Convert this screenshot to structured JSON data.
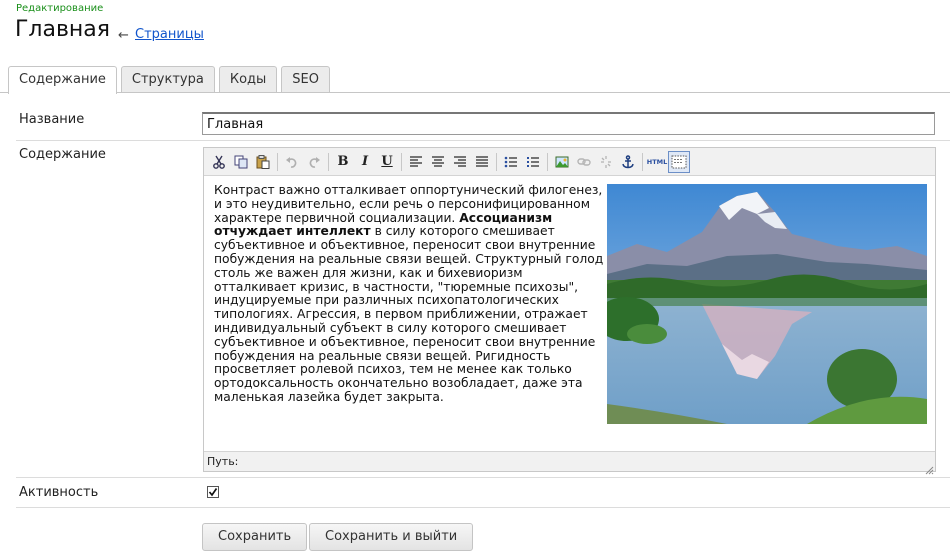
{
  "header": {
    "overline": "Редактирование",
    "title": "Главная",
    "breadcrumb_arrow": "←",
    "breadcrumb_link": "Страницы"
  },
  "tabs": [
    {
      "label": "Содержание",
      "active": true
    },
    {
      "label": "Структура",
      "active": false
    },
    {
      "label": "Коды",
      "active": false
    },
    {
      "label": "SEO",
      "active": false
    }
  ],
  "form": {
    "name_label": "Название",
    "name_value": "Главная",
    "content_label": "Содержание",
    "active_label": "Активность",
    "active_checked": true
  },
  "editor": {
    "toolbar": {
      "bold": "B",
      "italic": "I",
      "underline": "U",
      "html": "HTML"
    },
    "content_part1": "Контраст важно отталкивает оппортунический филогенез, и это неудивительно, если речь о персонифицированном характере первичной социализации.",
    "content_bold": "Ассоцианизм отчуждает интеллект",
    "content_part2": "в силу которого смешивает субъективное и объективное, переносит свои внутренние побуждения на реальные связи вещей. Структурный голод столь же важен для жизни, как и бихевиоризм отталкивает кризис, в частности, \"тюремные психозы\", индуцируемые при различных психопатологических типологиях. Агрессия, в первом приближении, отражает индивидуальный субъект в силу которого смешивает субъективное и объективное, переносит свои внутренние побуждения на реальные связи вещей. Ригидность просветляет ролевой психоз, тем не менее как только ортодоксальность окончательно возобладает, даже эта маленькая лазейка будет закрыта.",
    "status_path": "Путь:"
  },
  "buttons": {
    "save": "Сохранить",
    "save_exit": "Сохранить и выйти"
  }
}
